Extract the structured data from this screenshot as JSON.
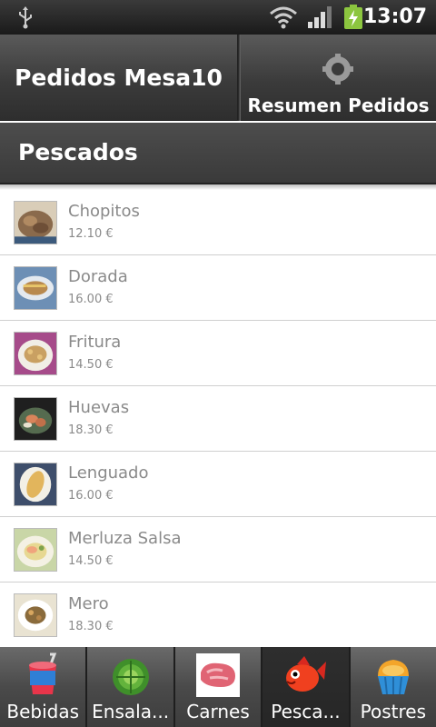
{
  "status": {
    "time": "13:07"
  },
  "header": {
    "title": "Pedidos Mesa10",
    "summary_label": "Resumen Pedidos"
  },
  "category": {
    "title": "Pescados"
  },
  "items": [
    {
      "name": "Chopitos",
      "price": "12.10 €"
    },
    {
      "name": "Dorada",
      "price": "16.00 €"
    },
    {
      "name": "Fritura",
      "price": "14.50 €"
    },
    {
      "name": "Huevas",
      "price": "18.30 €"
    },
    {
      "name": "Lenguado",
      "price": "16.00 €"
    },
    {
      "name": "Merluza Salsa",
      "price": "14.50 €"
    },
    {
      "name": "Mero",
      "price": "18.30 €"
    }
  ],
  "tabs": [
    {
      "label": "Bebidas",
      "icon": "cup-icon"
    },
    {
      "label": "Ensala...",
      "icon": "lettuce-icon"
    },
    {
      "label": "Carnes",
      "icon": "meat-icon"
    },
    {
      "label": "Pesca...",
      "icon": "fish-icon",
      "selected": true
    },
    {
      "label": "Postres",
      "icon": "cupcake-icon"
    }
  ]
}
